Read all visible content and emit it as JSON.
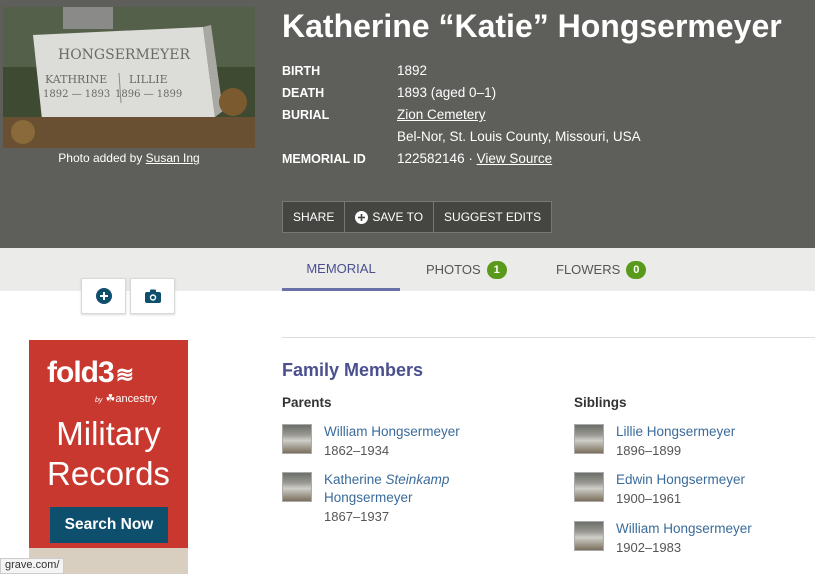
{
  "memorial": {
    "title": "Katherine “Katie” Hongsermeyer",
    "photo_caption_prefix": "Photo added by ",
    "photo_author": "Susan Ing",
    "gravestone": {
      "surname": "HONGSERMEYER",
      "left_name": "KATHRINE",
      "left_dates": "1892 — 1893",
      "right_name": "LILLIE",
      "right_dates": "1896 — 1899"
    },
    "facts": {
      "birth_label": "BIRTH",
      "birth_value": "1892",
      "death_label": "DEATH",
      "death_value": "1893 (aged 0–1)",
      "burial_label": "BURIAL",
      "burial_cemetery": "Zion Cemetery",
      "burial_location": "Bel-Nor, St. Louis County, Missouri, USA",
      "memorial_id_label": "MEMORIAL ID",
      "memorial_id_value": "122582146 · ",
      "view_source": "View Source"
    },
    "actions": {
      "share": "SHARE",
      "save_to": "SAVE TO",
      "suggest_edits": "SUGGEST EDITS"
    }
  },
  "tabs": {
    "memorial": "MEMORIAL",
    "photos": "PHOTOS",
    "photos_count": "1",
    "flowers": "FLOWERS",
    "flowers_count": "0"
  },
  "ad": {
    "logo": "fold3",
    "by_prefix": "by",
    "by_brand": "ancestry",
    "title_line1": "Military",
    "title_line2": "Records",
    "button": "Search Now"
  },
  "status_url": "grave.com/",
  "family": {
    "heading": "Family Members",
    "parents_heading": "Parents",
    "siblings_heading": "Siblings",
    "parents": [
      {
        "name": "William Hongsermeyer",
        "dates": "1862–1934"
      },
      {
        "name_first": "Katherine ",
        "name_maiden": "Steinkamp",
        "name_last": "Hongsermeyer",
        "dates": "1867–1937"
      }
    ],
    "siblings": [
      {
        "name": "Lillie Hongsermeyer",
        "dates": "1896–1899"
      },
      {
        "name": "Edwin Hongsermeyer",
        "dates": "1900–1961"
      },
      {
        "name": "William Hongsermeyer",
        "dates": "1902–1983"
      }
    ]
  },
  "colors": {
    "header_bg": "#5e5e5a",
    "accent": "#4a4f8f",
    "link": "#3a6b9a",
    "badge_green": "#5a9a1a",
    "ad_red": "#c8382e"
  }
}
